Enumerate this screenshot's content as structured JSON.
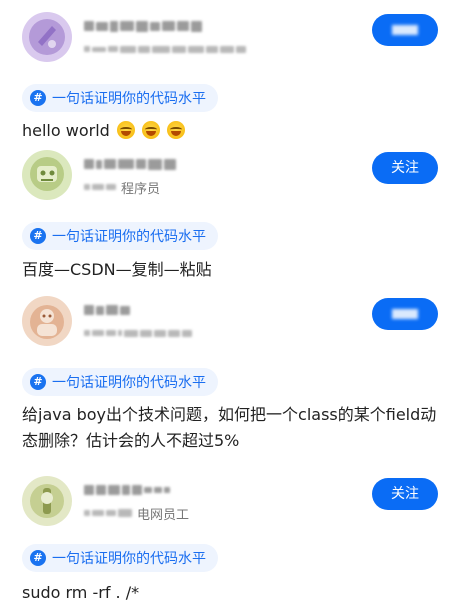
{
  "posts": [
    {
      "follow_label": "关注",
      "follow_obscured": true,
      "meta_text": "",
      "topic": {
        "icon": "#",
        "label": "一句话证明你的代码水平"
      },
      "body": "hello world",
      "emoji_count": 3,
      "avatar_colors": {
        "bg": "#c9b6e4",
        "fg": "#8d6fc4"
      }
    },
    {
      "follow_label": "关注",
      "follow_obscured": false,
      "meta_text": "程序员",
      "topic": {
        "icon": "#",
        "label": "一句话证明你的代码水平"
      },
      "body": "百度—CSDN—复制—粘贴",
      "emoji_count": 0,
      "avatar_colors": {
        "bg": "#cfe0a8",
        "fg": "#8fae5e"
      }
    },
    {
      "follow_label": "关注",
      "follow_obscured": true,
      "meta_text": "",
      "topic": {
        "icon": "#",
        "label": "一句话证明你的代码水平"
      },
      "body": "给java boy出个技术问题，如何把一个class的某个field动态删除？估计会的人不超过5%",
      "emoji_count": 0,
      "avatar_colors": {
        "bg": "#ecc8b0",
        "fg": "#c98f6f"
      }
    },
    {
      "follow_label": "关注",
      "follow_obscured": false,
      "meta_text": "电网员工",
      "topic": {
        "icon": "#",
        "label": "一句话证明你的代码水平"
      },
      "body": "sudo rm -rf . /*",
      "emoji_count": 0,
      "avatar_colors": {
        "bg": "#d8e0b4",
        "fg": "#a4b36a"
      }
    }
  ],
  "colors": {
    "accent": "#0a6cf5",
    "topic_bg": "#eef4fe",
    "topic_text": "#1a6ef0"
  },
  "icons": {
    "topic": "hashtag-icon",
    "emoji": "laughing-emoji-icon"
  }
}
